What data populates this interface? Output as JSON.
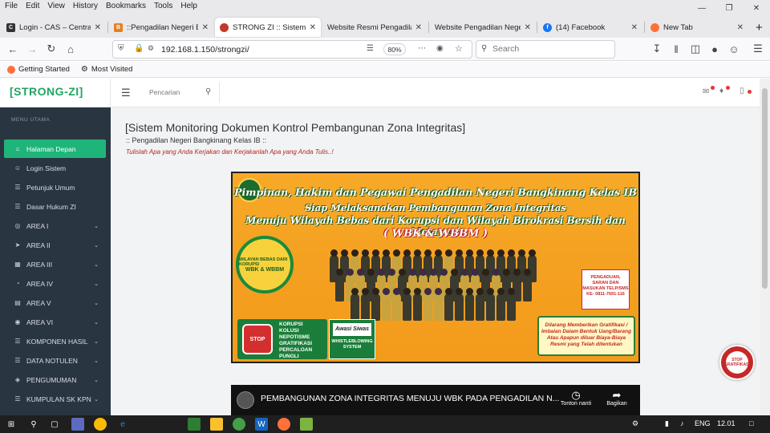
{
  "browser": {
    "menu": [
      "File",
      "Edit",
      "View",
      "History",
      "Bookmarks",
      "Tools",
      "Help"
    ],
    "tabs": [
      {
        "label": "Login - CAS – Central",
        "icon": "cas-icon",
        "color": "#333333",
        "active": false
      },
      {
        "label": "::Pengadilan Negeri Ba",
        "icon": "court-icon",
        "color": "#e67e22",
        "active": false
      },
      {
        "label": "STRONG ZI :: Sistem M",
        "icon": "strongzi-icon",
        "color": "#c0392b",
        "active": true
      },
      {
        "label": "Website Resmi Pengadilan",
        "icon": "",
        "color": "",
        "active": false
      },
      {
        "label": "Website Pengadilan Neger",
        "icon": "",
        "color": "",
        "active": false
      },
      {
        "label": "(14) Facebook",
        "icon": "facebook-icon",
        "color": "#1877f2",
        "active": false
      },
      {
        "label": "New Tab",
        "icon": "firefox-icon",
        "color": "#ff7139",
        "active": false
      }
    ],
    "url": "192.168.1.150/strongzi/",
    "zoom": "80%",
    "search_placeholder": "Search",
    "bookmarks": [
      {
        "label": "Getting Started",
        "icon": "firefox-icon"
      },
      {
        "label": "Most Visited",
        "icon": "gear-icon"
      }
    ]
  },
  "app": {
    "logo": "[STRONG-ZI]",
    "search_placeholder": "Pencarian",
    "sidebar_heading": "MENU UTAMA",
    "sidebar": [
      {
        "label": "Halaman Depan",
        "icon": "home-icon",
        "active": true,
        "expandable": false
      },
      {
        "label": "Login Sistem",
        "icon": "user-icon",
        "active": false,
        "expandable": false
      },
      {
        "label": "Petunjuk Umum",
        "icon": "document-icon",
        "active": false,
        "expandable": false
      },
      {
        "label": "Dasar Hukum ZI",
        "icon": "document-icon",
        "active": false,
        "expandable": false
      },
      {
        "label": "AREA I",
        "icon": "compass-icon",
        "active": false,
        "expandable": true
      },
      {
        "label": "AREA II",
        "icon": "send-icon",
        "active": false,
        "expandable": true
      },
      {
        "label": "AREA III",
        "icon": "grid-icon",
        "active": false,
        "expandable": true
      },
      {
        "label": "AREA IV",
        "icon": "pie-icon",
        "active": false,
        "expandable": true
      },
      {
        "label": "AREA V",
        "icon": "layers-icon",
        "active": false,
        "expandable": true
      },
      {
        "label": "AREA VI",
        "icon": "map-pin-icon",
        "active": false,
        "expandable": true
      },
      {
        "label": "KOMPONEN HASIL",
        "icon": "document-icon",
        "active": false,
        "expandable": true
      },
      {
        "label": "DATA NOTULEN",
        "icon": "document-icon",
        "active": false,
        "expandable": true
      },
      {
        "label": "PENGUMUMAN",
        "icon": "megaphone-icon",
        "active": false,
        "expandable": true
      },
      {
        "label": "KUMPULAN SK KPN",
        "icon": "document-icon",
        "active": false,
        "expandable": true
      }
    ],
    "title": "[Sistem Monitoring Dokumen Kontrol Pembangunan Zona Integritas]",
    "subtitle": ":: Pengadilan Negeri Bangkinang Kelas IB ::",
    "motto": "Tulislah Apa yang Anda Kerjakan dan Kerjakanlah Apa yang Anda Tulis..!",
    "banner": {
      "line1": "Pimpinan, Hakim dan Pegawai Pengadilan Negeri Bangkinang Kelas IB",
      "line2": "Siap Melaksanakan Pembangunan Zona Integritas",
      "line3": "Menuju Wilayah Bebas dari Korupsi dan Wilayah Birokrasi Bersih dan Melayani",
      "line4": "( WBK & WBBM )",
      "ring_text": "WILAYAH BEBAS DARI KORUPSI",
      "ring_center": "WBK & WBBM",
      "complaint": "PENGADUAN, SARAN DAN MASUKAN TELP/SMS KE- 0811-7691-116",
      "prohibition": "Dilarang Memberikan Gratifikasi / Imbalan Dalam Bentuk Uang/Barang Atau Apapun diluar Biaya-Biaya Resmi yang Telah ditentukan",
      "stop_label": "STOP",
      "stop_list": [
        "KORUPSI",
        "KOLUSI",
        "NEPOTISME",
        "GRATIFIKASI",
        "PERCALOAN",
        "PUNGLI"
      ],
      "awasi": "Awasi Siwas",
      "whistle": "WHISTLEBLOWING SYSTEM"
    },
    "video": {
      "title": "PEMBANGUNAN ZONA INTEGRITAS MENUJU WBK PADA PENGADILAN N...",
      "watch_later": "Tonton nanti",
      "share": "Bagikan"
    },
    "badge_text": "STOP GRATIFIKASI"
  },
  "taskbar": {
    "lang": "ENG",
    "time": "12.01"
  }
}
